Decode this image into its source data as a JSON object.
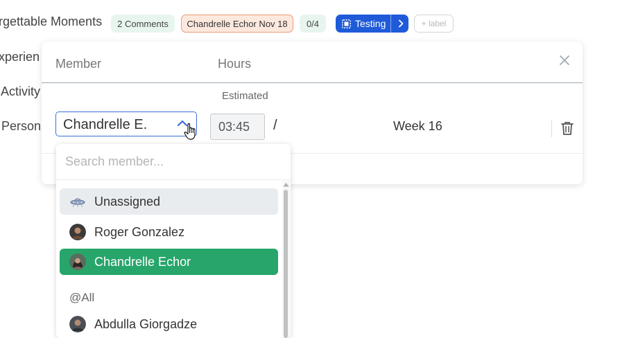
{
  "card": {
    "title": "rgettable Moments",
    "comments_label": "2 Comments",
    "due_label": "Chandrelle Echor Nov 18",
    "checklist_label": "0/4",
    "status_label": "Testing",
    "add_label": "+ label"
  },
  "side_labels": [
    "xperien",
    "Activity",
    "Person"
  ],
  "modal": {
    "member_header": "Member",
    "hours_header": "Hours",
    "estimated_label": "Estimated",
    "selected_member": "Chandrelle E.",
    "hours_value": "03:45",
    "separator": "/",
    "week_label": "Week 16"
  },
  "dropdown": {
    "search_placeholder": "Search member...",
    "options": [
      {
        "label": "Unassigned",
        "icon": "ufo-icon",
        "state": "hover"
      },
      {
        "label": "Roger Gonzalez",
        "icon": "avatar",
        "state": "normal"
      },
      {
        "label": "Chandrelle Echor",
        "icon": "avatar",
        "state": "selected"
      }
    ],
    "group_label": "@All",
    "group_options": [
      {
        "label": "Abdulla Giorgadze",
        "icon": "avatar"
      }
    ]
  },
  "colors": {
    "accent_blue": "#1f5bd9",
    "selected_green": "#27a56a",
    "comments_bg": "#e8f5ef",
    "date_bg": "#fde8de",
    "date_border": "#e89a73",
    "hover_bg": "#e9ecef"
  }
}
